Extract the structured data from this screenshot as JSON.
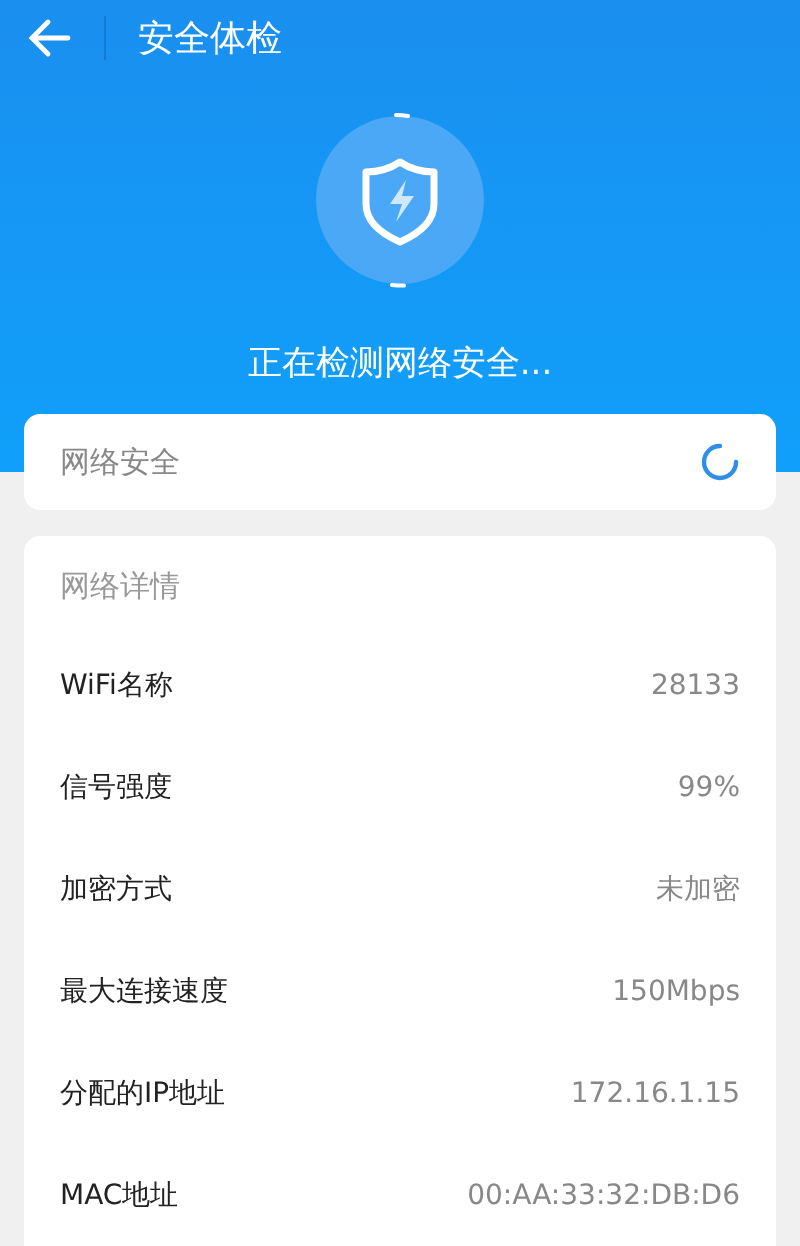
{
  "header": {
    "title": "安全体检",
    "status": "正在检测网络安全..."
  },
  "security": {
    "label": "网络安全"
  },
  "details": {
    "title": "网络详情",
    "rows": [
      {
        "label": "WiFi名称",
        "value": "28133"
      },
      {
        "label": "信号强度",
        "value": "99%"
      },
      {
        "label": "加密方式",
        "value": "未加密"
      },
      {
        "label": "最大连接速度",
        "value": "150Mbps"
      },
      {
        "label": "分配的IP地址",
        "value": "172.16.1.15"
      },
      {
        "label": "MAC地址",
        "value": "00:AA:33:32:DB:D6"
      }
    ]
  }
}
